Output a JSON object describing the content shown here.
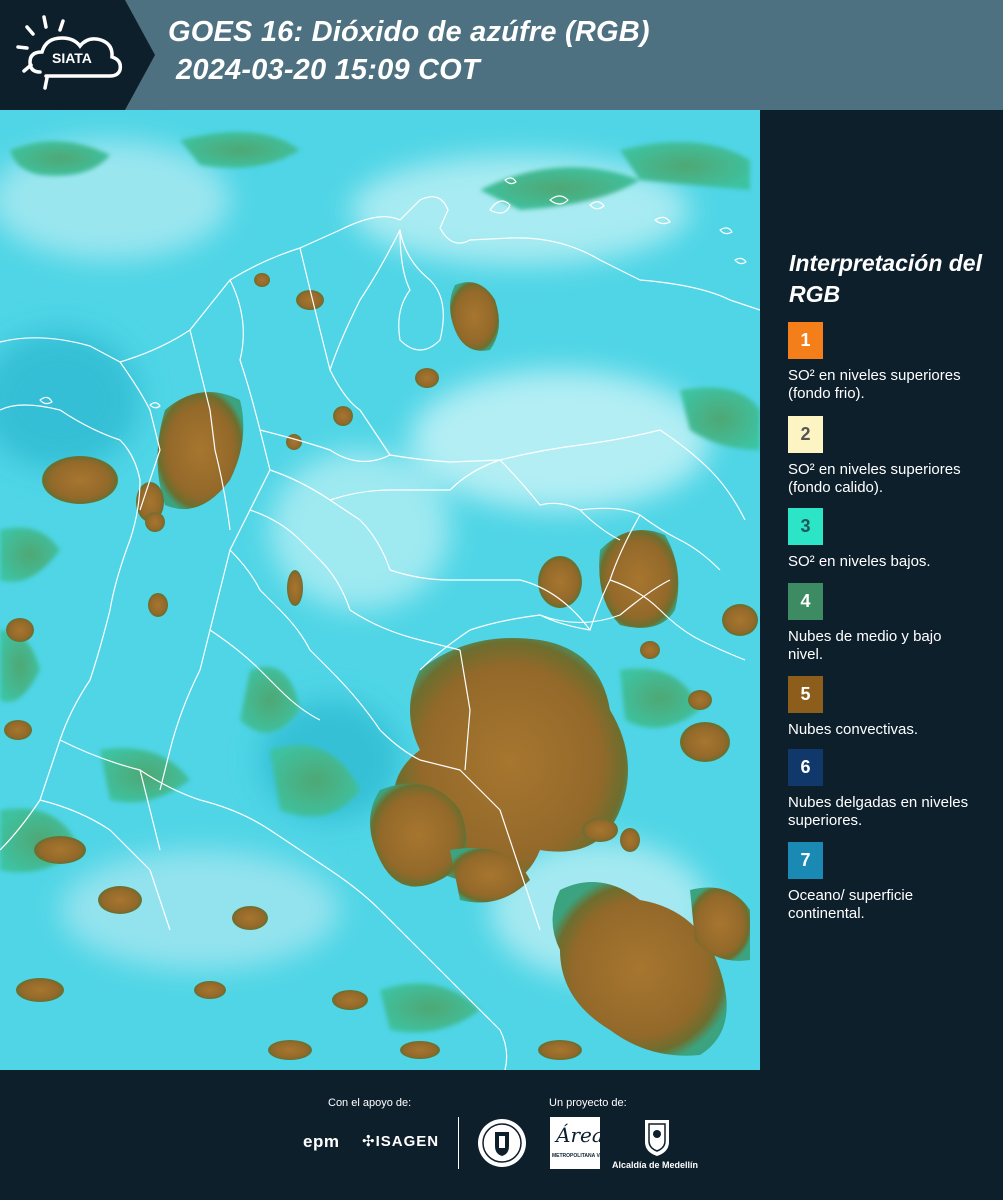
{
  "header": {
    "logo_text": "SIATA",
    "title_line1": "GOES 16: Dióxido de azúfre (RGB)",
    "title_line2": "2024-03-20 15:09 COT"
  },
  "legend": {
    "title": "Interpretación del RGB",
    "items": [
      {
        "number": "1",
        "label": "SO² en niveles superiores (fondo frio).",
        "color": "#f47f1a",
        "text_color": "#ffffff"
      },
      {
        "number": "2",
        "label": "SO² en niveles superiores (fondo calido).",
        "color": "#fdf4c4",
        "text_color": "#555555"
      },
      {
        "number": "3",
        "label": "SO² en niveles bajos.",
        "color": "#2ce5c6",
        "text_color": "#1c5a5a"
      },
      {
        "number": "4",
        "label": "Nubes de medio y bajo nivel.",
        "color": "#3c8b62",
        "text_color": "#ffffff"
      },
      {
        "number": "5",
        "label": "Nubes convectivas.",
        "color": "#8c5d1b",
        "text_color": "#ffffff"
      },
      {
        "number": "6",
        "label": "Nubes delgadas en niveles superiores.",
        "color": "#11386a",
        "text_color": "#ffffff"
      },
      {
        "number": "7",
        "label": "Oceano/ superficie continental.",
        "color": "#1a8ab4",
        "text_color": "#ffffff"
      }
    ]
  },
  "footer": {
    "support_caption": "Con el apoyo de:",
    "project_caption": "Un proyecto de:",
    "sponsor_1": "epm",
    "sponsor_2": "ISAGEN",
    "partner_area": "Área",
    "partner_area_sub": "METROPOLITANA Valle de Aburrá",
    "partner_alcaldia": "Alcaldía de Medellín"
  },
  "colors": {
    "header_bg": "#4e7181",
    "logo_tab": "#0e1f2c",
    "panel_bg": "#0e1f2c",
    "map_base": "#4fd5e6",
    "cloud_convective": "#9b6e2c",
    "cloud_low": "#3aa07c"
  }
}
